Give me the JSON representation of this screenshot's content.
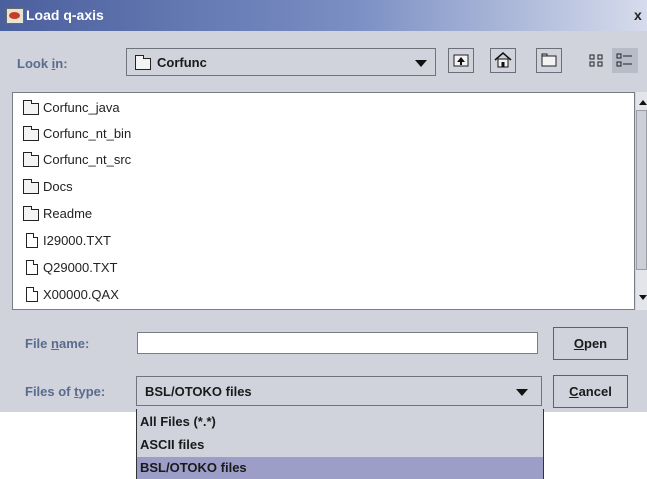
{
  "window": {
    "title": "Load q-axis",
    "close_glyph": "x"
  },
  "look_in": {
    "label": "Look in:",
    "mnemonic": "i",
    "value": "Corfunc",
    "folder_icon": "folder-icon"
  },
  "toolbar": [
    {
      "name": "up-one-level-button",
      "icon": "up-folder-icon"
    },
    {
      "name": "home-button",
      "icon": "home-icon"
    },
    {
      "name": "new-folder-button",
      "icon": "new-folder-icon"
    },
    {
      "name": "list-view-button",
      "icon": "list-view-icon"
    },
    {
      "name": "details-view-button",
      "icon": "details-view-icon",
      "pressed": true
    }
  ],
  "files": [
    {
      "name": "Corfunc_java",
      "type": "folder"
    },
    {
      "name": "Corfunc_nt_bin",
      "type": "folder"
    },
    {
      "name": "Corfunc_nt_src",
      "type": "folder"
    },
    {
      "name": "Docs",
      "type": "folder"
    },
    {
      "name": "Readme",
      "type": "folder"
    },
    {
      "name": "I29000.TXT",
      "type": "file"
    },
    {
      "name": "Q29000.TXT",
      "type": "file"
    },
    {
      "name": "X00000.QAX",
      "type": "file"
    }
  ],
  "file_name": {
    "label": "File name:",
    "value": ""
  },
  "files_of_type": {
    "label": "Files of type:",
    "value": "BSL/OTOKO files",
    "options": [
      "All Files (*.*)",
      "ASCII files",
      "BSL/OTOKO files"
    ],
    "selected_index": 2
  },
  "buttons": {
    "open": "Open",
    "cancel": "Cancel"
  },
  "colors": {
    "dialog_bg": "#d0d2dc",
    "title_gradient_start": "#4a5f9d",
    "label_text": "#5a6c8e",
    "selected_option": "#9c9ec8"
  }
}
